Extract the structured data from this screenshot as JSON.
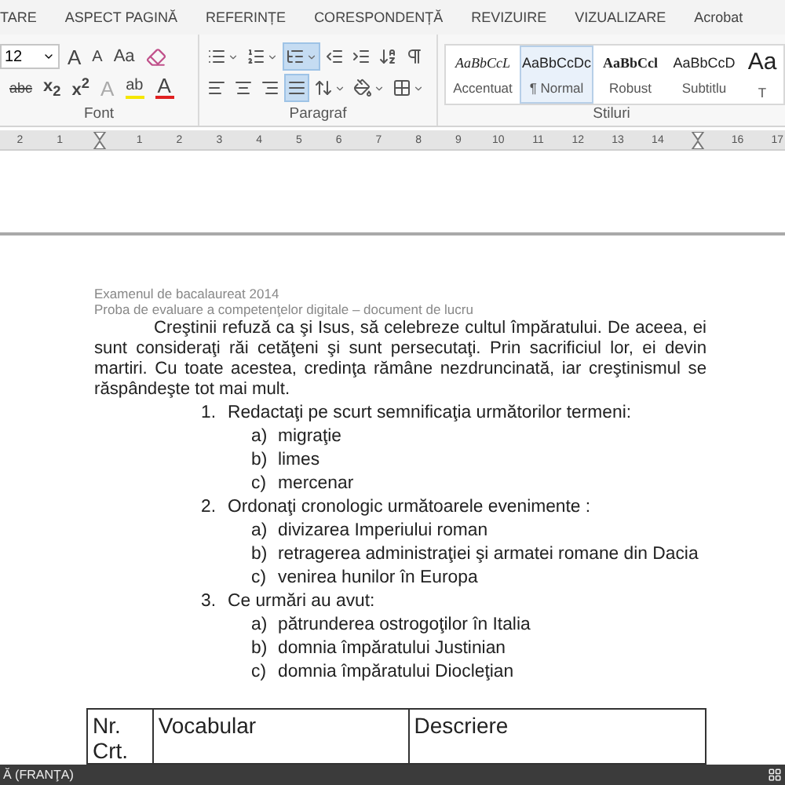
{
  "ribbon_tabs": [
    {
      "label": "TARE",
      "selected": false
    },
    {
      "label": "ASPECT PAGINĂ",
      "selected": false
    },
    {
      "label": "REFERINȚE",
      "selected": false
    },
    {
      "label": "CORESPONDENȚĂ",
      "selected": false
    },
    {
      "label": "REVIZUIRE",
      "selected": false
    },
    {
      "label": "VIZUALIZARE",
      "selected": false
    },
    {
      "label": "Acrobat",
      "selected": false
    }
  ],
  "font_group": {
    "label": "Font",
    "size": "12",
    "row1": [
      {
        "kind": "grow",
        "label": "A"
      },
      {
        "kind": "shrink",
        "label": "A"
      },
      {
        "kind": "case",
        "label": "Aa"
      },
      {
        "kind": "clear"
      }
    ],
    "row2": [
      {
        "kind": "strike",
        "label": "abc"
      },
      {
        "kind": "sub",
        "label": "x$_{2}$"
      },
      {
        "kind": "sup",
        "label": "x$^{2}$"
      },
      {
        "kind": "effects",
        "label": "A"
      },
      {
        "kind": "highlight",
        "label": "ab"
      },
      {
        "kind": "color",
        "label": "A"
      }
    ]
  },
  "paragraph_group": {
    "label": "Paragraf",
    "row1": [
      {
        "kind": "bullets",
        "selected": false
      },
      {
        "kind": "numbering",
        "selected": false
      },
      {
        "kind": "multilevel",
        "selected": true
      },
      {
        "kind": "outdent",
        "selected": false
      },
      {
        "kind": "indent",
        "selected": false
      },
      {
        "kind": "sort",
        "selected": false
      },
      {
        "kind": "pilcrow",
        "selected": false
      }
    ],
    "row2": [
      {
        "kind": "left",
        "selected": false
      },
      {
        "kind": "center",
        "selected": false
      },
      {
        "kind": "right",
        "selected": false
      },
      {
        "kind": "justify",
        "selected": true
      },
      {
        "kind": "spacing",
        "selected": false
      },
      {
        "kind": "shading",
        "selected": false
      },
      {
        "kind": "borders",
        "selected": false
      }
    ]
  },
  "styles_group": {
    "label": "Stiluri",
    "items": [
      {
        "preview": "AaBbCcL",
        "label": "Accentuat",
        "kind": "italic",
        "selected": false
      },
      {
        "preview": "AaBbCcDc",
        "label": "¶ Normal",
        "kind": "plain",
        "selected": true
      },
      {
        "preview": "AaBbCcl",
        "label": "Robust",
        "kind": "bold",
        "selected": false
      },
      {
        "preview": "AaBbCcD",
        "label": "Subtitlu",
        "kind": "plain",
        "selected": false
      },
      {
        "preview": "Aa",
        "label": "T",
        "kind": "title",
        "selected": false
      }
    ]
  },
  "ruler": [
    {
      "kind": "number",
      "label": "2"
    },
    {
      "kind": "number",
      "label": "1"
    },
    {
      "kind": "marker"
    },
    {
      "kind": "number",
      "label": "1"
    },
    {
      "kind": "number",
      "label": "2"
    },
    {
      "kind": "number",
      "label": "3"
    },
    {
      "kind": "number",
      "label": "4"
    },
    {
      "kind": "number",
      "label": "5"
    },
    {
      "kind": "number",
      "label": "6"
    },
    {
      "kind": "number",
      "label": "7"
    },
    {
      "kind": "number",
      "label": "8"
    },
    {
      "kind": "number",
      "label": "9"
    },
    {
      "kind": "number",
      "label": "10"
    },
    {
      "kind": "number",
      "label": "11"
    },
    {
      "kind": "number",
      "label": "12"
    },
    {
      "kind": "number",
      "label": "13"
    },
    {
      "kind": "number",
      "label": "14"
    },
    {
      "kind": "marker"
    },
    {
      "kind": "number",
      "label": "16"
    },
    {
      "kind": "number",
      "label": "17"
    }
  ],
  "document": {
    "header": [
      "Examenul de bacalaureat 2014",
      "Proba de evaluare a competenţelor digitale – document de lucru"
    ],
    "paragraph": "Creştinii refuză ca şi Isus, să celebreze cultul împăratului. De aceea, ei sunt consideraţi răi cetăţeni şi sunt persecutaţi. Prin sacrificiul lor, ei devin martiri. Cu toate acestea, credinţa rămâne nezdruncinată, iar creştinismul se răspândeşte tot mai mult.",
    "questions": [
      {
        "number": "1.",
        "text": "Redactaţi pe scurt semnificaţia următorilor termeni:",
        "items": [
          {
            "marker": "a)",
            "text": "migraţie"
          },
          {
            "marker": "b)",
            "text": "limes"
          },
          {
            "marker": "c)",
            "text": "mercenar"
          }
        ]
      },
      {
        "number": "2.",
        "text": "Ordonaţi cronologic următoarele evenimente :",
        "items": [
          {
            "marker": "a)",
            "text": "divizarea Imperiului roman"
          },
          {
            "marker": "b)",
            "text": "retragerea administraţiei şi armatei romane din Dacia"
          },
          {
            "marker": "c)",
            "text": "venirea hunilor în Europa"
          }
        ]
      },
      {
        "number": "3.",
        "text": "Ce urmări au avut:",
        "items": [
          {
            "marker": "a)",
            "text": "pătrunderea ostrogoţilor în Italia"
          },
          {
            "marker": "b)",
            "text": "domnia împăratului Justinian"
          },
          {
            "marker": "c)",
            "text": "domnia împăratului Diocleţian"
          }
        ]
      }
    ],
    "table": {
      "columns": [
        "Nr. Crt.",
        "Vocabular",
        "Descriere"
      ]
    }
  },
  "status_bar": {
    "language": "Ă (FRANŢA)"
  }
}
